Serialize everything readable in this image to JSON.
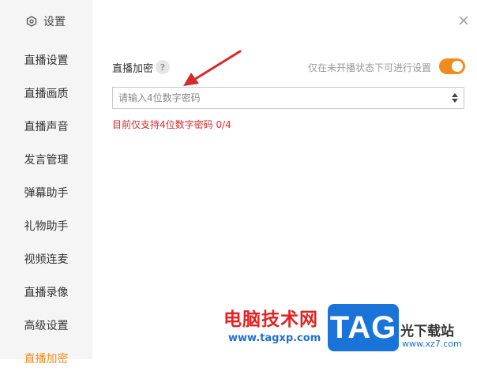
{
  "sidebar": {
    "title": "设置",
    "items": [
      {
        "label": "直播设置"
      },
      {
        "label": "直播画质"
      },
      {
        "label": "直播声音"
      },
      {
        "label": "发言管理"
      },
      {
        "label": "弹幕助手"
      },
      {
        "label": "礼物助手"
      },
      {
        "label": "视频连麦"
      },
      {
        "label": "直播录像"
      },
      {
        "label": "高级设置"
      },
      {
        "label": "直播加密"
      }
    ],
    "active_index": 9
  },
  "panel": {
    "title": "直播加密",
    "help_symbol": "?",
    "hint": "仅在未开播状态下可进行设置",
    "toggle_on": true,
    "password_placeholder": "请输入4位数字密码",
    "password_value": "",
    "error": "目前仅支持4位数字密码 0/4"
  },
  "watermark": {
    "cn": "电脑技术网",
    "url": "www.tagxp.com",
    "badge": "TAG",
    "site": "光下载站",
    "site_url": "www.xz7.com"
  },
  "colors": {
    "accent": "#f08c1e",
    "error": "#d9292b",
    "arrow": "#d42a2a",
    "sidebar_bg": "#f5f5f5"
  },
  "icons": {
    "settings": "hexagon-gear-icon",
    "close": "close-icon",
    "help": "question-icon",
    "stepper": "up-down-stepper-icon"
  }
}
